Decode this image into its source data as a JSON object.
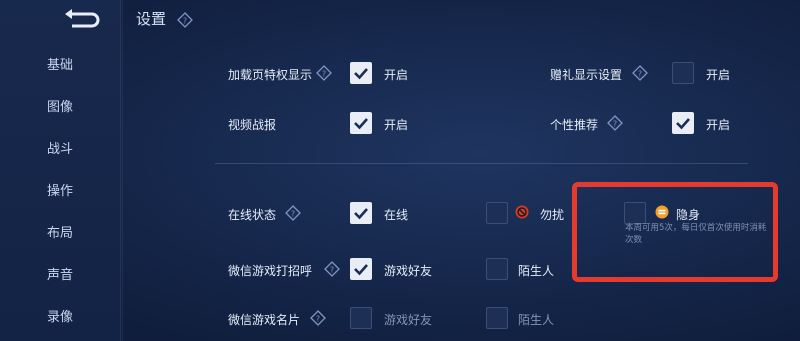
{
  "header": {
    "title": "设置"
  },
  "sidebar": {
    "items": [
      {
        "label": "基础"
      },
      {
        "label": "图像"
      },
      {
        "label": "战斗"
      },
      {
        "label": "操作"
      },
      {
        "label": "布局"
      },
      {
        "label": "声音"
      },
      {
        "label": "录像"
      }
    ]
  },
  "rows": {
    "loading_privilege": {
      "label": "加载页特权显示",
      "option": "开启",
      "checked": true
    },
    "gift_display": {
      "label": "赠礼显示设置",
      "option": "开启",
      "checked": false
    },
    "video_report": {
      "label": "视频战报",
      "option": "开启",
      "checked": true
    },
    "personalized": {
      "label": "个性推荐",
      "option": "开启",
      "checked": true
    },
    "online_status": {
      "label": "在线状态",
      "options": [
        {
          "label": "在线",
          "checked": true
        },
        {
          "label": "勿扰",
          "checked": false
        },
        {
          "label": "隐身",
          "checked": false
        }
      ],
      "note": "本周可用5次，每日仅首次使用时消耗次数"
    },
    "wechat_greeting": {
      "label": "微信游戏打招呼",
      "options": [
        {
          "label": "游戏好友",
          "checked": true
        },
        {
          "label": "陌生人",
          "checked": false
        }
      ]
    },
    "wechat_card": {
      "label": "微信游戏名片",
      "options": [
        {
          "label": "游戏好友",
          "checked": false
        },
        {
          "label": "陌生人",
          "checked": false
        }
      ]
    }
  },
  "colors": {
    "accent": "#e9eef6",
    "highlight": "#e53a2e",
    "dnd": "#d43b2b",
    "invisible": "#f0a030"
  }
}
